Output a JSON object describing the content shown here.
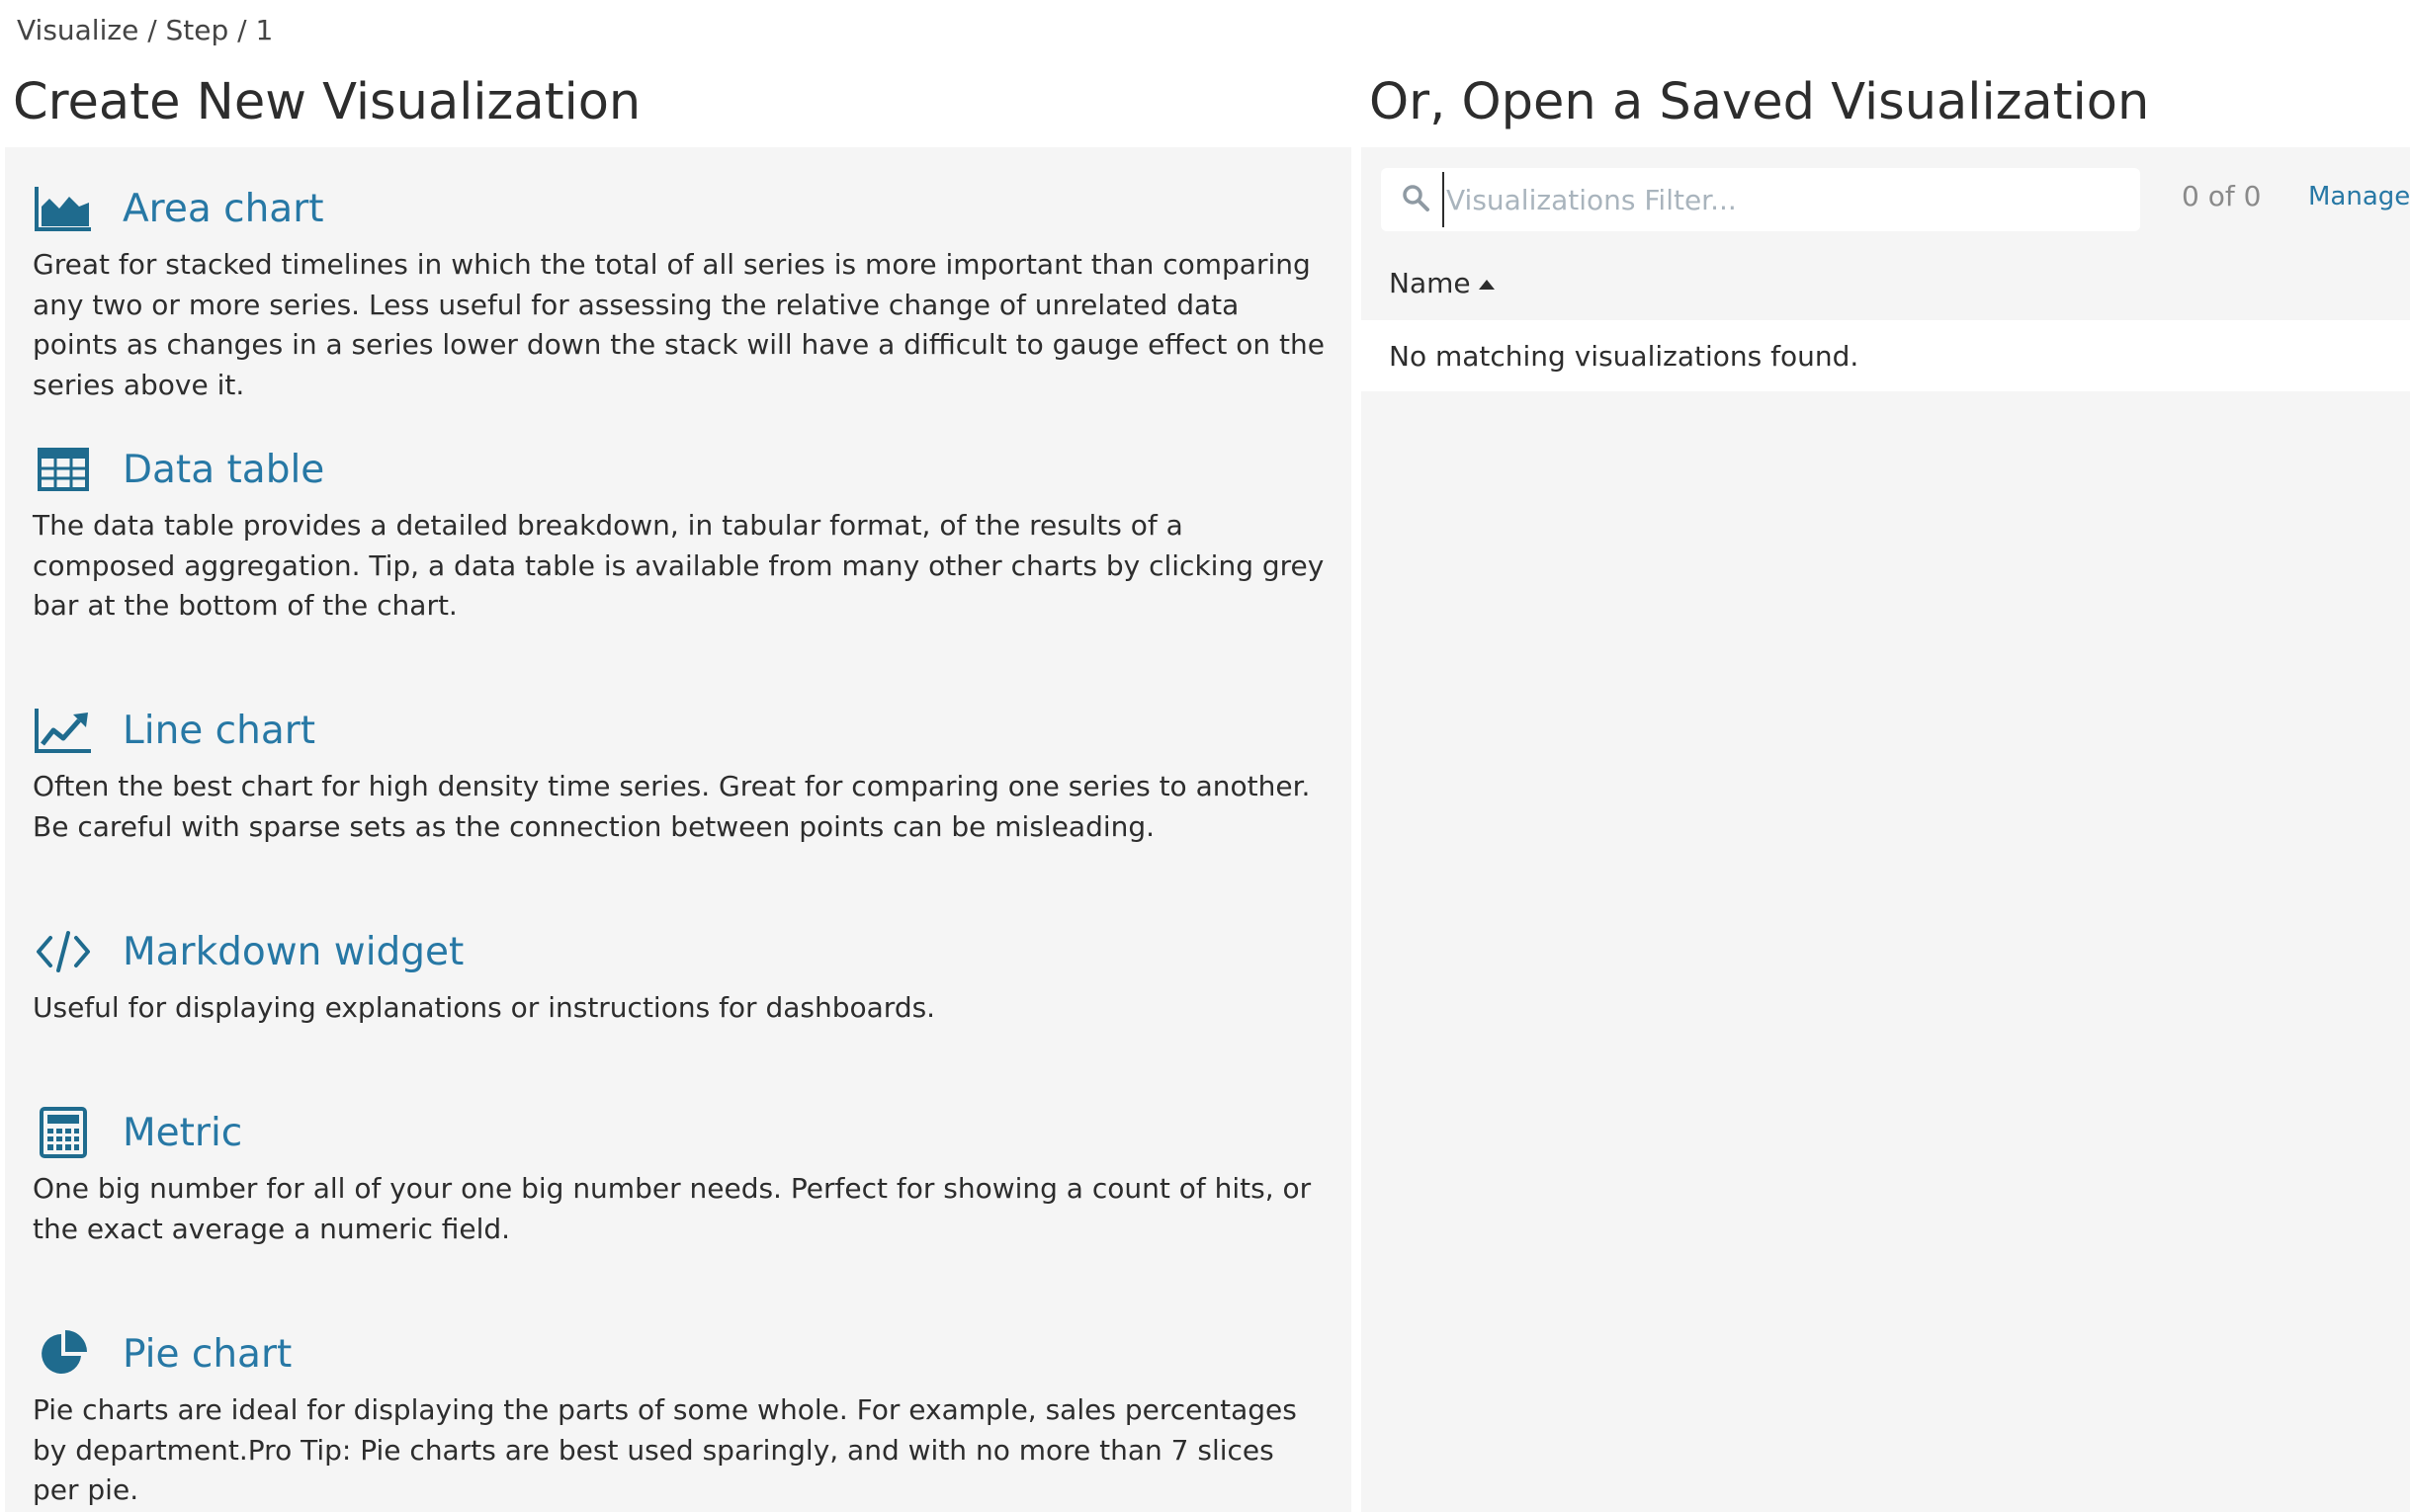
{
  "breadcrumb": "Visualize / Step / 1",
  "left": {
    "title": "Create New Visualization",
    "items": [
      {
        "name": "Area chart",
        "icon": "area-chart-icon",
        "description": "Great for stacked timelines in which the total of all series is more important than comparing any two or more series. Less useful for assessing the relative change of unrelated data points as changes in a series lower down the stack will have a difficult to gauge effect on the series above it."
      },
      {
        "name": "Data table",
        "icon": "table-icon",
        "description": "The data table provides a detailed breakdown, in tabular format, of the results of a composed aggregation. Tip, a data table is available from many other charts by clicking grey bar at the bottom of the chart."
      },
      {
        "name": "Line chart",
        "icon": "line-chart-icon",
        "description": "Often the best chart for high density time series. Great for comparing one series to another. Be careful with sparse sets as the connection between points can be misleading."
      },
      {
        "name": "Markdown widget",
        "icon": "code-icon",
        "description": "Useful for displaying explanations or instructions for dashboards."
      },
      {
        "name": "Metric",
        "icon": "calculator-icon",
        "description": "One big number for all of your one big number needs. Perfect for showing a count of hits, or the exact average a numeric field."
      },
      {
        "name": "Pie chart",
        "icon": "pie-chart-icon",
        "description": "Pie charts are ideal for displaying the parts of some whole. For example, sales percentages by department.Pro Tip: Pie charts are best used sparingly, and with no more than 7 slices per pie."
      }
    ]
  },
  "right": {
    "title": "Or, Open a Saved Visualization",
    "search": {
      "placeholder": "Visualizations Filter...",
      "value": "",
      "icon": "search-icon"
    },
    "pager": "0 of 0",
    "manage_label": "Manage",
    "column_header": "Name",
    "empty_message": "No matching visualizations found."
  },
  "colors": {
    "accent": "#2778a5",
    "icon": "#1f6b8e",
    "panel_bg": "#f5f5f5",
    "text": "#2d2d2d"
  }
}
